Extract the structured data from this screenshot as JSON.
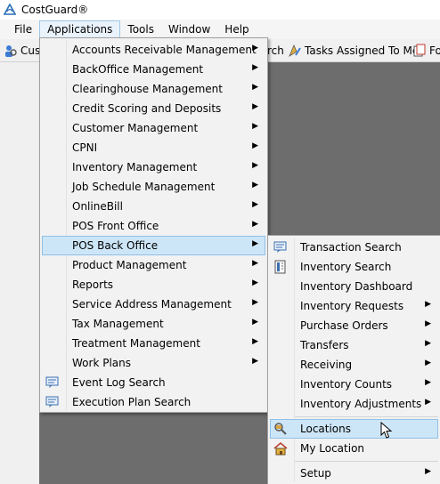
{
  "window": {
    "title": "CostGuard®"
  },
  "menubar": [
    {
      "label": "File"
    },
    {
      "label": "Applications"
    },
    {
      "label": "Tools"
    },
    {
      "label": "Window"
    },
    {
      "label": "Help"
    }
  ],
  "toolbar": {
    "item1": "Cus",
    "item2": "rch",
    "item3": "Tasks Assigned To Me",
    "item4": "Fo"
  },
  "applications_menu": [
    {
      "label": "Accounts Receivable Management",
      "submenu": true
    },
    {
      "label": "BackOffice Management",
      "submenu": true
    },
    {
      "label": "Clearinghouse Management",
      "submenu": true
    },
    {
      "label": "Credit Scoring and Deposits",
      "submenu": true
    },
    {
      "label": "Customer Management",
      "submenu": true
    },
    {
      "label": "CPNI",
      "submenu": true
    },
    {
      "label": "Inventory Management",
      "submenu": true
    },
    {
      "label": "Job Schedule Management",
      "submenu": true
    },
    {
      "label": "OnlineBill",
      "submenu": true
    },
    {
      "label": "POS Front Office",
      "submenu": true
    },
    {
      "label": "POS Back Office",
      "submenu": true
    },
    {
      "label": "Product Management",
      "submenu": true
    },
    {
      "label": "Reports",
      "submenu": true
    },
    {
      "label": "Service Address Management",
      "submenu": true
    },
    {
      "label": "Tax Management",
      "submenu": true
    },
    {
      "label": "Treatment Management",
      "submenu": true
    },
    {
      "label": "Work Plans",
      "submenu": true
    },
    {
      "label": "Event Log Search",
      "icon": "event-log-icon"
    },
    {
      "label": "Execution Plan Search",
      "icon": "execution-plan-icon"
    }
  ],
  "pos_back_office_menu": [
    {
      "label": "Transaction Search",
      "icon": "transaction-search-icon"
    },
    {
      "label": "Inventory Search",
      "icon": "inventory-search-icon"
    },
    {
      "label": "Inventory Dashboard"
    },
    {
      "label": "Inventory Requests",
      "submenu": true
    },
    {
      "label": "Purchase Orders",
      "submenu": true
    },
    {
      "label": "Transfers",
      "submenu": true
    },
    {
      "label": "Receiving",
      "submenu": true
    },
    {
      "label": "Inventory Counts",
      "submenu": true
    },
    {
      "label": "Inventory Adjustments",
      "submenu": true
    },
    {
      "label": "Locations",
      "icon": "locations-icon"
    },
    {
      "label": "My Location",
      "icon": "home-icon"
    },
    {
      "label": "Setup",
      "submenu": true
    }
  ],
  "colors": {
    "highlight": "#cde6f7",
    "highlight_border": "#8fc0e7",
    "workspace": "#6d6d6d"
  }
}
